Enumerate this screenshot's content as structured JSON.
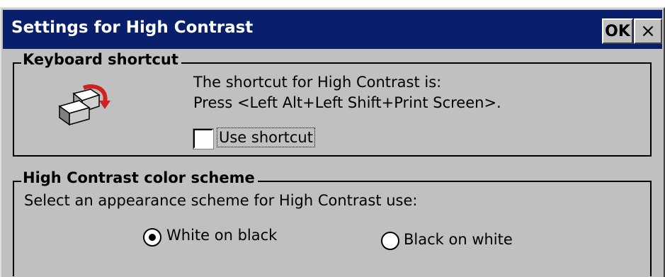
{
  "dialog": {
    "title": "Settings for High Contrast",
    "ok_label": "OK",
    "close_label": "×"
  },
  "keyboard_shortcut": {
    "group_label": "Keyboard shortcut",
    "line1": "The shortcut for High Contrast is:",
    "line2": "Press <Left Alt+Left Shift+Print Screen>.",
    "checkbox_label": "Use shortcut",
    "checkbox_checked": false,
    "icon": "keyboard-keys-icon"
  },
  "color_scheme": {
    "group_label": "High Contrast color scheme",
    "instruction": "Select an appearance scheme for High Contrast use:",
    "options": [
      {
        "label": "White on black",
        "selected": true
      },
      {
        "label": "Black on white",
        "selected": false
      }
    ]
  },
  "colors": {
    "titlebar": "#0a1f6b",
    "face": "#c0c0c0"
  }
}
